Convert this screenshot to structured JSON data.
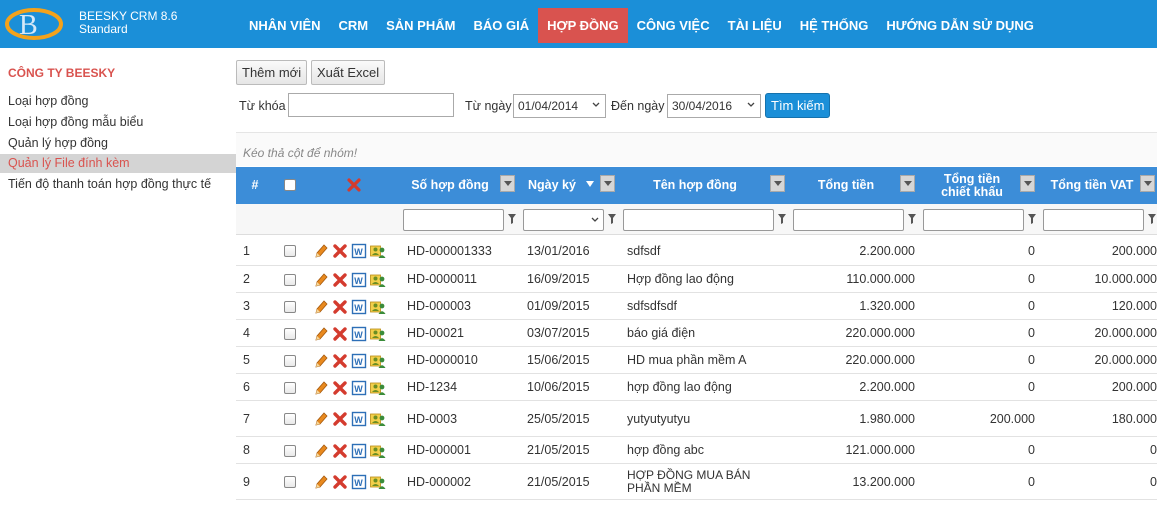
{
  "app": {
    "name": "BEESKY CRM 8.6",
    "edition": "Standard"
  },
  "nav": [
    {
      "label": "NHÂN VIÊN",
      "active": false
    },
    {
      "label": "CRM",
      "active": false
    },
    {
      "label": "SẢN PHẨM",
      "active": false
    },
    {
      "label": "BÁO GIÁ",
      "active": false
    },
    {
      "label": "HỢP ĐỒNG",
      "active": true
    },
    {
      "label": "CÔNG VIỆC",
      "active": false
    },
    {
      "label": "TÀI LIỆU",
      "active": false
    },
    {
      "label": "HỆ THỐNG",
      "active": false
    },
    {
      "label": "HƯỚNG DẪN SỬ DỤNG",
      "active": false
    }
  ],
  "sidebar": {
    "company": "CÔNG TY BEESKY",
    "items": [
      {
        "label": "Loại hợp đồng",
        "active": false
      },
      {
        "label": "Loại hợp đồng mẫu biểu",
        "active": false
      },
      {
        "label": "Quản lý hợp đồng",
        "active": false
      },
      {
        "label": "Quản lý File đính kèm",
        "active": true
      },
      {
        "label": "Tiến độ thanh toán hợp đồng thực tế",
        "active": false
      }
    ]
  },
  "toolbar": {
    "add_label": "Thêm mới",
    "export_label": "Xuất Excel",
    "keyword_label": "Từ khóa",
    "keyword_value": "",
    "from_label": "Từ ngày",
    "from_value": "01/04/2014",
    "to_label": "Đến ngày",
    "to_value": "30/04/2016",
    "search_label": "Tìm kiếm"
  },
  "grid": {
    "group_hint": "Kéo thả cột để nhóm!",
    "headers": {
      "index": "#",
      "code": "Số hợp đồng",
      "date": "Ngày ký",
      "name": "Tên hợp đồng",
      "total": "Tổng tiền",
      "discount_line1": "Tổng tiền",
      "discount_line2": "chiết khấu",
      "vat": "Tổng tiền VAT"
    },
    "rows": [
      {
        "index": "1",
        "code": "HD-000001333",
        "date": "13/01/2016",
        "name": "sdfsdf",
        "total": "2.200.000",
        "discount": "0",
        "vat": "200.000"
      },
      {
        "index": "2",
        "code": "HD-0000011",
        "date": "16/09/2015",
        "name": "Hợp đồng lao động",
        "total": "110.000.000",
        "discount": "0",
        "vat": "10.000.000"
      },
      {
        "index": "3",
        "code": "HD-000003",
        "date": "01/09/2015",
        "name": "sdfsdfsdf",
        "total": "1.320.000",
        "discount": "0",
        "vat": "120.000"
      },
      {
        "index": "4",
        "code": "HD-00021",
        "date": "03/07/2015",
        "name": "báo giá điện",
        "total": "220.000.000",
        "discount": "0",
        "vat": "20.000.000"
      },
      {
        "index": "5",
        "code": "HD-0000010",
        "date": "15/06/2015",
        "name": "HD mua phần mềm A",
        "total": "220.000.000",
        "discount": "0",
        "vat": "20.000.000"
      },
      {
        "index": "6",
        "code": "HD-1234",
        "date": "10/06/2015",
        "name": "hợp đồng lao động",
        "total": "2.200.000",
        "discount": "0",
        "vat": "200.000"
      },
      {
        "index": "7",
        "code": "HD-0003",
        "date": "25/05/2015",
        "name": "yutyutyutyu",
        "total": "1.980.000",
        "discount": "200.000",
        "vat": "180.000"
      },
      {
        "index": "8",
        "code": "HD-000001",
        "date": "21/05/2015",
        "name": "hợp đồng abc",
        "total": "121.000.000",
        "discount": "0",
        "vat": "0"
      },
      {
        "index": "9",
        "code": "HD-000002",
        "date": "21/05/2015",
        "name": "HỢP ĐỒNG MUA BÁN PHẦN MỀM",
        "total": "13.200.000",
        "discount": "0",
        "vat": "0"
      }
    ]
  },
  "colors": {
    "header_blue": "#1b8fd8",
    "grid_blue": "#3c8dd8",
    "accent_red": "#d9534f"
  },
  "icons": {
    "edit": "pencil-icon",
    "delete": "delete-icon",
    "word": "word-document-icon",
    "users": "user-group-icon",
    "filter": "filter-icon"
  }
}
